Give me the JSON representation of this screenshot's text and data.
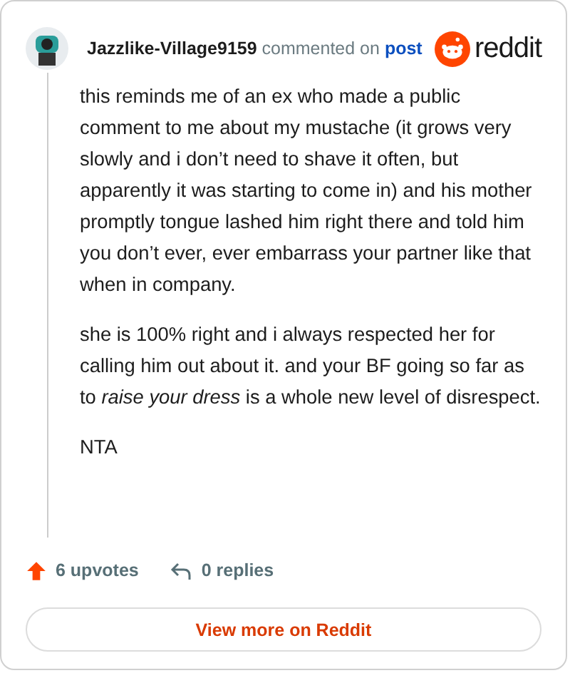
{
  "comment": {
    "author": "Jazzlike-Village9159",
    "action": "commented on",
    "link": "post",
    "brand": "reddit",
    "paragraphs": [
      "this reminds me of an ex who made a public comment to me about my mustache (it grows very slowly and i don’t need to shave it often, but apparently it was starting to come in) and his mother promptly tongue lashed him right there and told him you don’t ever, ever embarrass your partner like that when in company.",
      "she is 100% right and i always respected her for calling him out about it. and your BF going so far as to *raise your dress* is a whole new level of disrespect.",
      "NTA"
    ],
    "upvotes": "6 upvotes",
    "replies": "0 replies",
    "button": "View more on Reddit"
  }
}
